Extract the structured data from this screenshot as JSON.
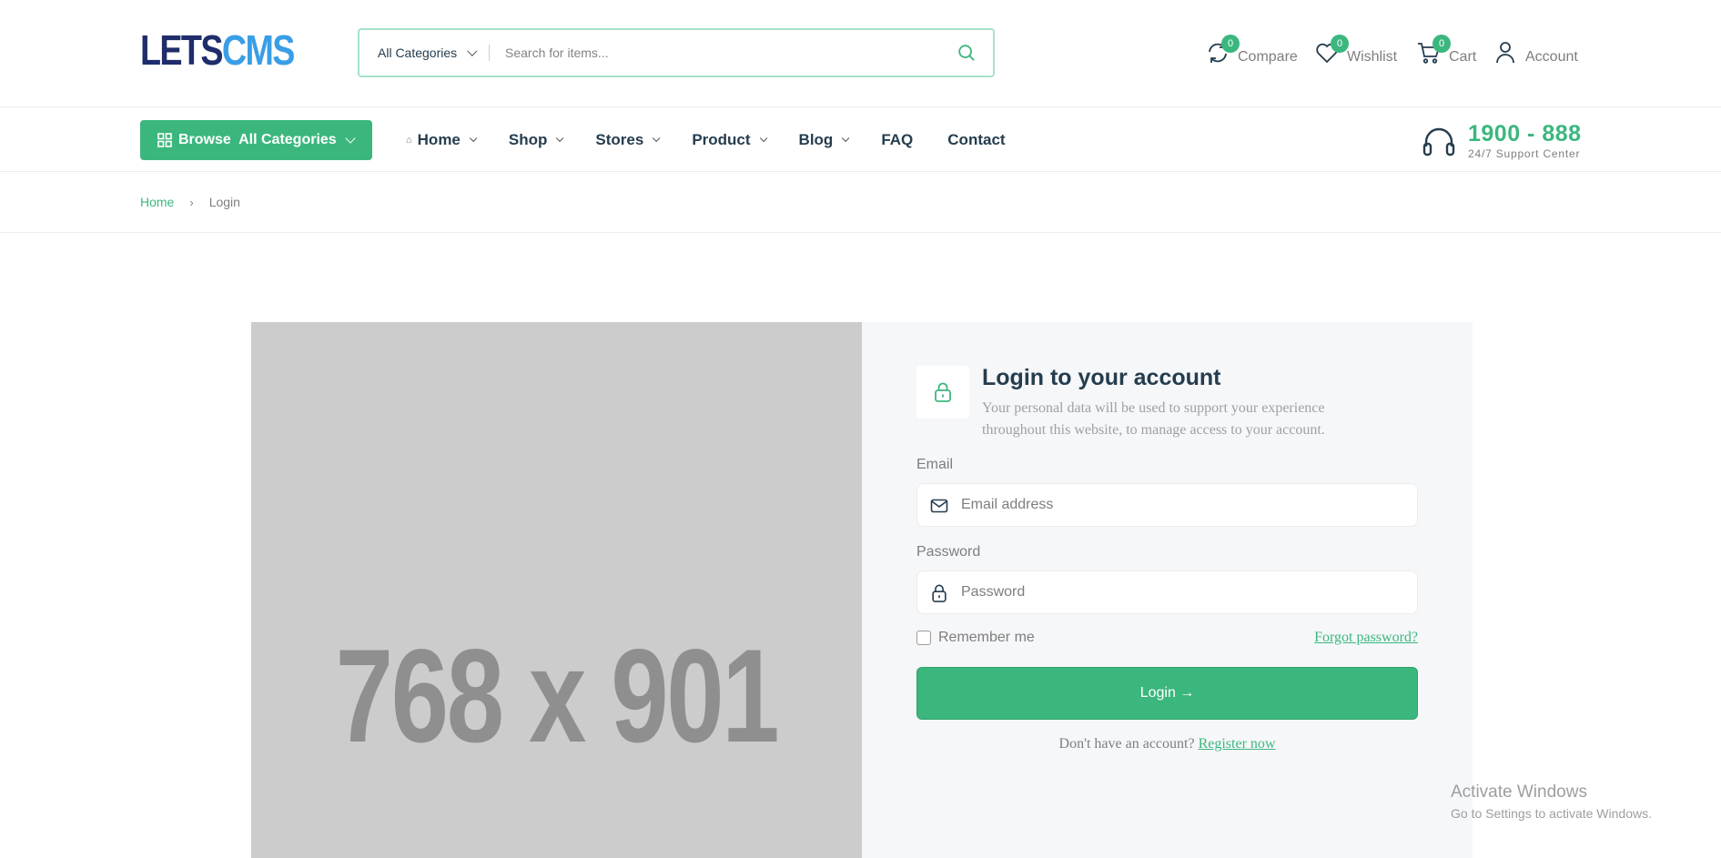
{
  "brand": {
    "logo_part1": "LETS",
    "logo_part2": "CMS"
  },
  "search": {
    "category": "All Categories",
    "placeholder": "Search for items..."
  },
  "header_actions": [
    {
      "label": "Compare",
      "count": "0"
    },
    {
      "label": "Wishlist",
      "count": "0"
    },
    {
      "label": "Cart",
      "count": "0"
    },
    {
      "label": "Account"
    }
  ],
  "nav": {
    "browse_label": "Browse  All Categories",
    "items": [
      {
        "label": "Home"
      },
      {
        "label": "Shop"
      },
      {
        "label": "Stores"
      },
      {
        "label": "Product"
      },
      {
        "label": "Blog"
      },
      {
        "label": "FAQ"
      },
      {
        "label": "Contact"
      }
    ],
    "support_number": "1900 - 888",
    "support_text": "24/7 Support Center"
  },
  "breadcrumb": {
    "home": "Home",
    "separator": "›",
    "current": "Login"
  },
  "image_placeholder": {
    "text": "768 x 901"
  },
  "login": {
    "title": "Login to your account",
    "description": "Your personal data will be used to support your experience throughout this website, to manage access to your account.",
    "email_label": "Email",
    "email_placeholder": "Email address",
    "password_label": "Password",
    "password_placeholder": "Password",
    "remember_label": "Remember me",
    "forgot_label": "Forgot password?",
    "submit_label": "Login →",
    "no_account_text": "Don't have an account?",
    "register_label": "Register now"
  },
  "os_watermark": {
    "line1": "Activate Windows",
    "line2": "Go to Settings to activate Windows."
  },
  "colors": {
    "accent": "#3bb77e",
    "heading": "#253d4e",
    "muted": "#7e7e7e",
    "logo_dark": "#1f2d6b",
    "logo_light": "#3a9ee6"
  }
}
